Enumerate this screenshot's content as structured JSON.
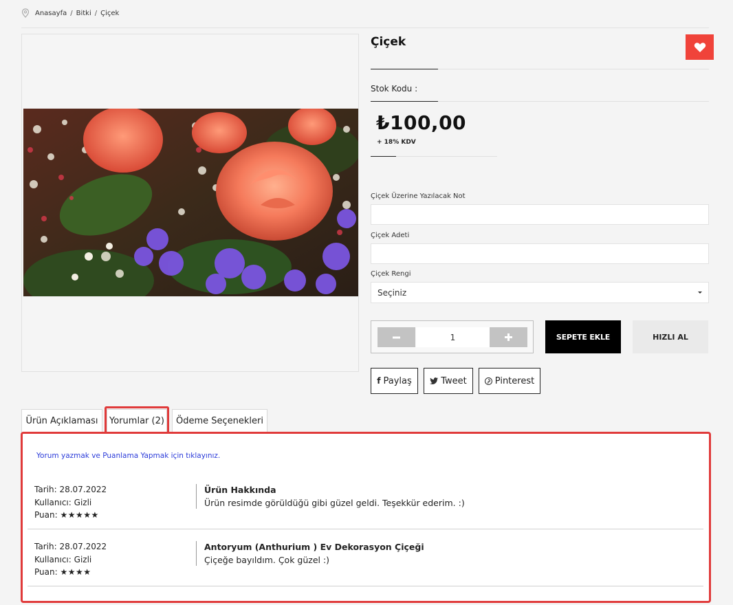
{
  "breadcrumb": {
    "items": [
      "Anasayfa",
      "Bitki",
      "Çiçek"
    ],
    "sep": "/"
  },
  "product": {
    "title": "Çiçek",
    "stock_label": "Stok Kodu :",
    "price": "₺100,00",
    "tax": "+ 18% KDV"
  },
  "form": {
    "note_label": "Çiçek Üzerine Yazılacak Not",
    "note_value": "",
    "count_label": "Çiçek Adeti",
    "count_value": "",
    "color_label": "Çiçek Rengi",
    "color_selected": "Seçiniz"
  },
  "cart": {
    "quantity": "1",
    "add_to_cart": "SEPETE EKLE",
    "quick_buy": "HIZLI AL"
  },
  "share": {
    "facebook": "Paylaş",
    "twitter": "Tweet",
    "pinterest": "Pinterest"
  },
  "tabs": [
    "Ürün Açıklaması",
    "Yorumlar (2)",
    "Ödeme Seçenekleri"
  ],
  "reviews_panel": {
    "write_link": "Yorum yazmak ve Puanlama Yapmak için tıklayınız.",
    "date_label": "Tarih:",
    "user_label": "Kullanıcı:",
    "rating_label": "Puan:",
    "reviews": [
      {
        "date": "28.07.2022",
        "user": "Gizli",
        "rating": 5,
        "stars": "★★★★★",
        "title": "Ürün Hakkında",
        "text": "Ürün resimde görüldüğü gibi güzel geldi. Teşekkür ederim. :)"
      },
      {
        "date": "28.07.2022",
        "user": "Gizli",
        "rating": 4,
        "stars": "★★★★",
        "title": "Antoryum (Anthurium ) Ev Dekorasyon Çiçeği",
        "text": "Çiçeğe bayıldım. Çok güzel :)"
      }
    ]
  },
  "colors": {
    "accent": "#f0433a",
    "highlight": "#e03a3a",
    "link": "#2b3bd9",
    "button_dark": "#000000"
  }
}
